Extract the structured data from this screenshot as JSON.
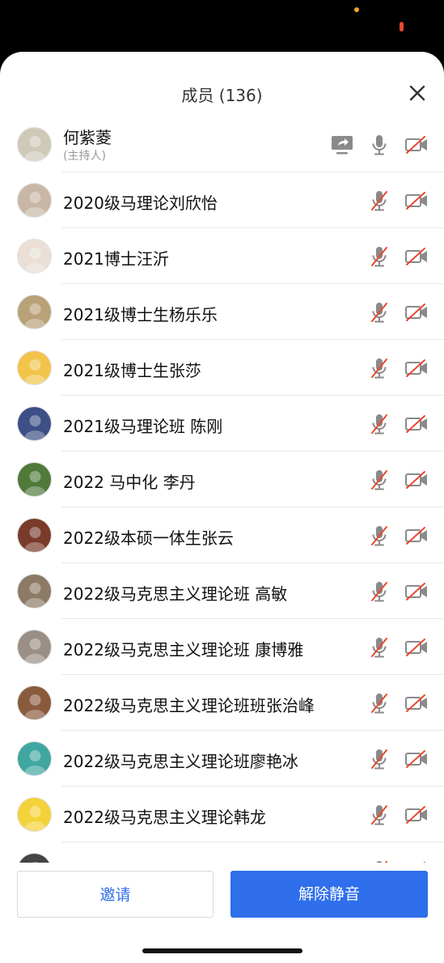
{
  "header": {
    "title": "成员 (136)"
  },
  "members": [
    {
      "name": "何紫菱",
      "role": "(主持人)",
      "host": true,
      "avatar_color": "#cfc9b8",
      "mic_muted": false,
      "cam_off": true
    },
    {
      "name": "2020级马理论刘欣怡",
      "avatar_color": "#c9b7a6",
      "mic_muted": true,
      "cam_off": true
    },
    {
      "name": "2021博士汪沂",
      "avatar_color": "#e9dfd6",
      "mic_muted": true,
      "cam_off": true
    },
    {
      "name": "2021级博士生杨乐乐",
      "avatar_color": "#b9a178",
      "mic_muted": true,
      "cam_off": true
    },
    {
      "name": "2021级博士生张莎",
      "avatar_color": "#f2c44a",
      "mic_muted": true,
      "cam_off": true
    },
    {
      "name": "2021级马理论班 陈刚",
      "avatar_color": "#3d4f86",
      "mic_muted": true,
      "cam_off": true
    },
    {
      "name": "2022 马中化 李丹",
      "avatar_color": "#4f7a3a",
      "mic_muted": true,
      "cam_off": true
    },
    {
      "name": "2022级本硕一体生张云",
      "avatar_color": "#7a3b2a",
      "mic_muted": true,
      "cam_off": true
    },
    {
      "name": "2022级马克思主义理论班 高敏",
      "avatar_color": "#8c7a66",
      "mic_muted": true,
      "cam_off": true
    },
    {
      "name": "2022级马克思主义理论班 康博雅",
      "avatar_color": "#9a8f86",
      "mic_muted": true,
      "cam_off": true
    },
    {
      "name": "2022级马克思主义理论班班张治峰",
      "avatar_color": "#8a5a3c",
      "mic_muted": true,
      "cam_off": true
    },
    {
      "name": "2022级马克思主义理论班廖艳冰",
      "avatar_color": "#3fa6a0",
      "mic_muted": true,
      "cam_off": true
    },
    {
      "name": "2022级马克思主义理论韩龙",
      "avatar_color": "#f4d23a",
      "mic_muted": true,
      "cam_off": true
    },
    {
      "name": "",
      "avatar_color": "#444444",
      "mic_muted": true,
      "cam_off": true
    }
  ],
  "footer": {
    "invite_label": "邀请",
    "unmute_label": "解除静音"
  },
  "colors": {
    "accent": "#2f6fec",
    "muted_red": "#e8472d",
    "icon_gray": "#8a8a8a"
  }
}
